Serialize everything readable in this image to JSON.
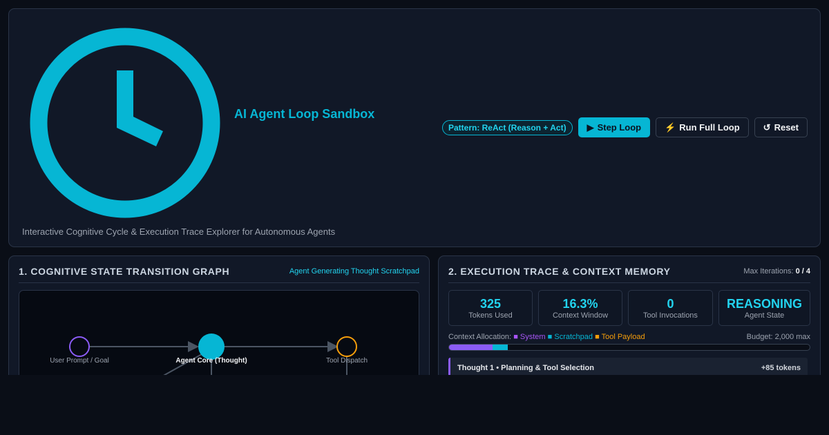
{
  "app": {
    "title": "AI Agent Loop Sandbox",
    "subtitle": "Interactive Cognitive Cycle & Execution Trace Explorer for Autonomous Agents",
    "logo_icon": "clock-icon",
    "accent_color": "#06b6d4"
  },
  "controls": {
    "pattern_label": "Pattern: ReAct (Reason + Act)",
    "step_label": "Step Loop",
    "run_label": "Run Full Loop",
    "reset_label": "Reset",
    "step_icon": "play-icon",
    "run_icon": "lightning-icon",
    "reset_icon": "reset-icon",
    "step_glyph": "▶",
    "run_glyph": "⚡",
    "reset_glyph": "↺"
  },
  "graph_panel": {
    "title": "1. COGNITIVE STATE TRANSITION GRAPH",
    "status": "Agent Generating Thought Scratchpad",
    "nodes": [
      {
        "id": "user",
        "label": "User Prompt / Goal",
        "color": "#8b5cf6",
        "active": false
      },
      {
        "id": "core",
        "label": "Agent Core (Thought)",
        "color": "#06b6d4",
        "active": true
      },
      {
        "id": "tool",
        "label": "Tool Dispatch",
        "color": "#f59e0b",
        "active": false
      }
    ]
  },
  "trace_panel": {
    "title": "2. EXECUTION TRACE & CONTEXT MEMORY",
    "iterations_label": "Max Iterations:",
    "iterations_value": "0 / 4",
    "metrics": [
      {
        "value": "325",
        "label": "Tokens Used"
      },
      {
        "value": "16.3%",
        "label": "Context Window"
      },
      {
        "value": "0",
        "label": "Tool Invocations"
      },
      {
        "value": "REASONING",
        "label": "Agent State"
      }
    ],
    "allocation": {
      "label": "Context Allocation:",
      "marker": "■",
      "system": "System",
      "scratchpad": "Scratchpad",
      "tool": "Tool Payload",
      "budget": "Budget: 2,000 max",
      "system_fraction": 0.12,
      "scratchpad_fraction": 0.043,
      "tool_fraction": 0,
      "colors": {
        "system": "#8b5cf6",
        "scratchpad": "#06b6d4",
        "tool": "#f59e0b"
      }
    },
    "trace_items": [
      {
        "title": "Thought 1 • Planning & Tool Selection",
        "tokens": "+85 tokens"
      }
    ]
  }
}
